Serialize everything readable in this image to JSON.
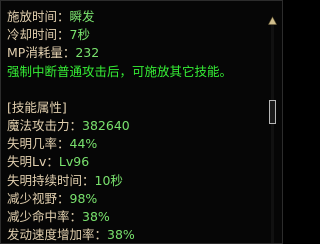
{
  "tooltip": {
    "lines": [
      {
        "label": "施放时间：",
        "value": "瞬发"
      },
      {
        "label": "冷却时间：",
        "value": "7秒"
      },
      {
        "label": "MP消耗量：",
        "value": "232"
      }
    ],
    "note": "强制中断普通攻击后，可施放其它技能。",
    "section_title": "[技能属性]",
    "attributes": [
      {
        "label": "魔法攻击力：",
        "value": "382640"
      },
      {
        "label": "失明几率：",
        "value": "44%"
      },
      {
        "label": "失明Lv：",
        "value": "Lv96"
      },
      {
        "label": "失明持续时间：",
        "value": "10秒"
      },
      {
        "label": "减少视野：",
        "value": "98%"
      },
      {
        "label": "减少命中率：",
        "value": "38%"
      },
      {
        "label": "发动速度增加率：",
        "value": "38%"
      }
    ]
  },
  "scrollbar": {
    "up_arrow_icon": "triangle-up-icon",
    "position_fraction": 0.41
  },
  "colors": {
    "label": "#e1cfae",
    "value": "#79e26d",
    "note": "#35ee35",
    "background": "#060606"
  }
}
